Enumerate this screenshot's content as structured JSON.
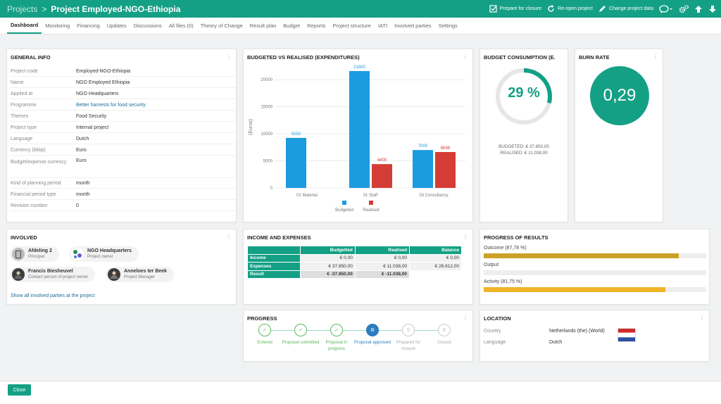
{
  "breadcrumb": {
    "root": "Projects",
    "separator": ">",
    "title": "Project Employed-NGO-Ethiopia"
  },
  "actions": {
    "prepare": "Prepare for closure",
    "reopen": "Re-open project",
    "change": "Change project data"
  },
  "tabs": [
    "Dashboard",
    "Monitoring",
    "Financing",
    "Updates",
    "Discussions",
    "All files (0)",
    "Theory of Change",
    "Result plan",
    "Budget",
    "Reports",
    "Project structure",
    "IATI",
    "Involved parties",
    "Settings"
  ],
  "general_info": {
    "title": "GENERAL INFO",
    "rows": [
      {
        "label": "Project code",
        "value": "Employed-NGO-Ethiopia"
      },
      {
        "label": "Name",
        "value": "NGO Employed Ethiopia"
      },
      {
        "label": "Applied at",
        "value": "NGO Headquarters"
      },
      {
        "label": "Programme",
        "value": "Better harvests for food security"
      },
      {
        "label": "Themes",
        "value": "Food Security"
      },
      {
        "label": "Project type",
        "value": "Internal project"
      },
      {
        "label": "Language",
        "value": "Dutch"
      },
      {
        "label": "Currency (bkkp)",
        "value": "Euro"
      },
      {
        "label": "Budget/expense currency",
        "value": "Euro"
      },
      {
        "label": "Kind of planning period",
        "value": "month"
      },
      {
        "label": "Financial period type",
        "value": "month"
      },
      {
        "label": "Revision number",
        "value": "0"
      }
    ]
  },
  "chart_title": "BUDGETED VS REALISED (EXPENDITURES)",
  "chart_data": {
    "type": "bar",
    "title": "BUDGETED VS REALISED (EXPENDITURES)",
    "ylabel": "(Euros)",
    "xlabel": "",
    "categories": [
      "02 Material",
      "01 Staff",
      "03 Consultancy"
    ],
    "series": [
      {
        "name": "Budgeted",
        "values": [
          9250,
          21600,
          7000
        ],
        "color": "#1b9be0"
      },
      {
        "name": "Realised",
        "values": [
          0,
          4400,
          6638
        ],
        "color": "#d33d35"
      }
    ],
    "ylim": [
      0,
      22500
    ],
    "yticks": [
      0,
      5000,
      10000,
      15000,
      20000
    ],
    "grid": true,
    "legend": "bottom"
  },
  "budget_consumption": {
    "title": "BUDGET CONSUMPTION (E...",
    "percent": "29 %",
    "fraction": 0.29,
    "budgeted": "BUDGETED: € 37.850,00",
    "realised": "REALISED: € 11.038,00",
    "color": "#14a085"
  },
  "burn_rate": {
    "title": "BURN RATE",
    "value": "0,29",
    "color": "#14a085"
  },
  "involved": {
    "title": "INVOLVED",
    "parties": [
      {
        "name": "Afdeling 2",
        "role": "Principal"
      },
      {
        "name": "NGO Headquarters",
        "role": "Project owner"
      },
      {
        "name": "Francis Biesheuvel",
        "role": "Contact person of project owner"
      },
      {
        "name": "Anneloes ter Beek",
        "role": "Project Manager"
      }
    ],
    "show_all": "Show all involved parties at the project"
  },
  "income": {
    "title": "INCOME AND EXPENSES",
    "columns": [
      "Budgetted",
      "Realised",
      "Balance"
    ],
    "rows": [
      {
        "label": "Income",
        "values": [
          "€ 0,00",
          "€ 0,00",
          "€ 0,00"
        ]
      },
      {
        "label": "Expenses",
        "values": [
          "€ 37.850,00",
          "€ 11.038,00",
          "€ 26.812,00"
        ]
      },
      {
        "label": "Result",
        "values": [
          "€ -37.850,00",
          "€ -11.038,00",
          ""
        ]
      }
    ]
  },
  "progress_results": {
    "title": "PROGRESS OF RESULTS",
    "items": [
      {
        "label": "Outcome (87,78 %)",
        "fraction": 0.8778,
        "color": "#c9a227"
      },
      {
        "label": "Output",
        "fraction": 0,
        "color": "#c9a227"
      },
      {
        "label": "Activity (81,75 %)",
        "fraction": 0.8175,
        "color": "#f0b429"
      }
    ]
  },
  "progress": {
    "title": "PROGRESS",
    "steps": [
      {
        "label": "Entered",
        "symbol": "✓",
        "state": "done"
      },
      {
        "label": "Proposal submitted",
        "symbol": "✓",
        "state": "done"
      },
      {
        "label": "Proposal in progress",
        "symbol": "✓",
        "state": "done"
      },
      {
        "label": "Proposal approved",
        "symbol": "⚙",
        "state": "current"
      },
      {
        "label": "Prepared for closure",
        "symbol": "5",
        "state": "todo"
      },
      {
        "label": "Closed",
        "symbol": "6",
        "state": "todo"
      }
    ]
  },
  "location": {
    "title": "LOCATION",
    "country_label": "Country",
    "country": "Netherlands (the) (World)",
    "language_label": "Language",
    "language": "Dutch"
  },
  "footer": {
    "close": "Close"
  },
  "colors": {
    "accent": "#14a085",
    "link": "#1f6d9a"
  },
  "icons": [
    "prepare-check-icon",
    "reopen-icon",
    "pencil-icon",
    "chat-icon",
    "gears-icon",
    "arrow-up-icon",
    "arrow-down-icon",
    "flag-netherlands-icon"
  ]
}
